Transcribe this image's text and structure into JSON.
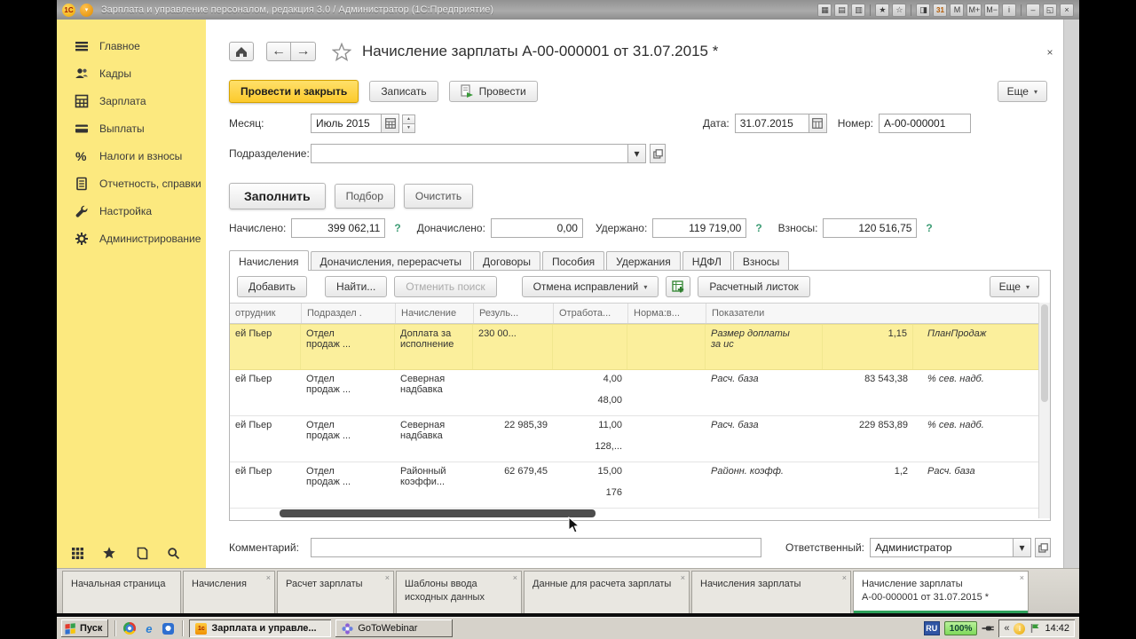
{
  "window": {
    "logo": "1С",
    "dropdown_glyph": "▾",
    "title": "Зарплата и управление персоналом, редакция 3.0 / Администратор (1С:Предприятие)",
    "toolbar": [
      {
        "name": "save-icon",
        "glyph": "▦"
      },
      {
        "name": "print-icon",
        "glyph": "▤"
      },
      {
        "name": "print-preview-icon",
        "glyph": "▥"
      },
      {
        "name": "add-favorite-icon",
        "glyph": "★"
      },
      {
        "name": "favorites-icon",
        "glyph": "☆"
      },
      {
        "name": "calculator-icon",
        "glyph": "◨"
      },
      {
        "name": "calendar-icon",
        "glyph": "31"
      },
      {
        "name": "memory-icon",
        "glyph": "M"
      },
      {
        "name": "memory-plus-icon",
        "glyph": "M+"
      },
      {
        "name": "memory-minus-icon",
        "glyph": "M−"
      },
      {
        "name": "info-icon",
        "glyph": "i"
      }
    ],
    "controls": {
      "minimize": "–",
      "restore": "◱",
      "close": "×"
    }
  },
  "sidebar": {
    "items": [
      {
        "label": "Главное"
      },
      {
        "label": "Кадры"
      },
      {
        "label": "Зарплата"
      },
      {
        "label": "Выплаты"
      },
      {
        "label": "Налоги и взносы"
      },
      {
        "label": "Отчетность, справки"
      },
      {
        "label": "Настройка"
      },
      {
        "label": "Администрирование"
      }
    ]
  },
  "doc": {
    "title": "Начисление зарплаты А-00-000001 от 31.07.2015 *",
    "close": "×",
    "nav": {
      "back": "←",
      "forward": "→"
    },
    "commands": {
      "post_and_close": "Провести и закрыть",
      "write": "Записать",
      "post": "Провести",
      "more": "Еще",
      "caret": "▾"
    },
    "fields": {
      "month_label": "Месяц:",
      "month_value": "Июль 2015",
      "department_label": "Подразделение:",
      "department_value": "",
      "date_label": "Дата:",
      "date_value": "31.07.2015",
      "number_label": "Номер:",
      "number_value": "А-00-000001"
    },
    "fill_buttons": {
      "fill": "Заполнить",
      "pick": "Подбор",
      "clear": "Очистить"
    },
    "totals": {
      "accrued_label": "Начислено:",
      "accrued_value": "399 062,11",
      "accrued_help": "?",
      "additional_label": "Доначислено:",
      "additional_value": "0,00",
      "withheld_label": "Удержано:",
      "withheld_value": "119 719,00",
      "withheld_help": "?",
      "contributions_label": "Взносы:",
      "contributions_value": "120 516,75",
      "contributions_help": "?"
    },
    "tabs": [
      {
        "label": "Начисления"
      },
      {
        "label": "Доначисления, перерасчеты"
      },
      {
        "label": "Договоры"
      },
      {
        "label": "Пособия"
      },
      {
        "label": "Удержания"
      },
      {
        "label": "НДФЛ"
      },
      {
        "label": "Взносы"
      }
    ],
    "grid": {
      "toolbar": {
        "add": "Добавить",
        "find": "Найти...",
        "cancel_search": "Отменить поиск",
        "undo_corrections": "Отмена исправлений",
        "payslip": "Расчетный листок",
        "more": "Еще"
      },
      "headers": {
        "employee": "отрудник",
        "department": "Подраздел .",
        "accrual": "Начисление",
        "result": "Резуль...",
        "worked": "Отработа...",
        "norm": "Норма:в...",
        "indicators": "Показатели"
      },
      "rows": [
        {
          "employee": "ей Пьер",
          "department": "Отдел\nпродаж ...",
          "accrual": "Доплата за\nисполнение",
          "result": "230 00...",
          "worked_1": "",
          "worked_2": "",
          "indicator_name": "Размер доплаты\nза ис",
          "indicator_value": "1,15",
          "indicator_name_2": "ПланПродаж"
        },
        {
          "employee": "ей Пьер",
          "department": "Отдел\nпродаж ...",
          "accrual": "Северная\nнадбавка",
          "result": "",
          "worked_1": "4,00",
          "worked_2": "48,00",
          "indicator_name": "Расч. база",
          "indicator_value": "83 543,38",
          "indicator_name_2": "% сев. надб."
        },
        {
          "employee": "ей Пьер",
          "department": "Отдел\nпродаж ...",
          "accrual": "Северная\nнадбавка",
          "result": "22 985,39",
          "worked_1": "11,00",
          "worked_2": "128,...",
          "indicator_name": "Расч. база",
          "indicator_value": "229 853,89",
          "indicator_name_2": "% сев. надб."
        },
        {
          "employee": "ей Пьер",
          "department": "Отдел\nпродаж ...",
          "accrual": "Районный\nкоэффи...",
          "result": "62 679,45",
          "worked_1": "15,00",
          "worked_2": "176",
          "indicator_name": "Районн. коэфф.",
          "indicator_value": "1,2",
          "indicator_name_2": "Расч. база"
        }
      ]
    },
    "footer": {
      "comment_label": "Комментарий:",
      "comment_value": "",
      "responsible_label": "Ответственный:",
      "responsible_value": "Администратор"
    }
  },
  "bottom_tabs": [
    {
      "label": "Начальная страница"
    },
    {
      "label": "Начисления",
      "close": "×"
    },
    {
      "label": "Расчет зарплаты",
      "close": "×"
    },
    {
      "label": "Шаблоны ввода исходных данных",
      "close": "×"
    },
    {
      "label": "Данные для расчета зарплаты",
      "close": "×"
    },
    {
      "label": "Начисления зарплаты",
      "close": "×"
    },
    {
      "label": "Начисление зарплаты",
      "label2": "А-00-000001 от 31.07.2015 *",
      "close": "×"
    }
  ],
  "taskbar": {
    "start": "Пуск",
    "ie_glyph": "e",
    "tasks": [
      {
        "label": "Зарплата и управле...",
        "icon_text": "1с"
      },
      {
        "label": "GoToWebinar"
      }
    ],
    "tray": {
      "lang": "RU",
      "battery": "100%",
      "collapse": "«",
      "info": "i",
      "time": "14:42"
    }
  },
  "colors": {
    "sidebar_yellow": "#FCE97F",
    "primary_button_yellow": "#FCCA2C",
    "selected_row_yellow": "#FBEF9C",
    "active_tab_underline": "#2DA05A",
    "help_link_green": "#3C9C74"
  }
}
